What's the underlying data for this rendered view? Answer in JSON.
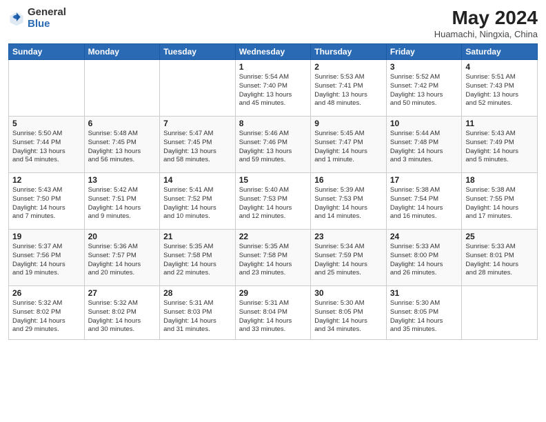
{
  "header": {
    "logo_general": "General",
    "logo_blue": "Blue",
    "month_title": "May 2024",
    "location": "Huamachi, Ningxia, China"
  },
  "days_of_week": [
    "Sunday",
    "Monday",
    "Tuesday",
    "Wednesday",
    "Thursday",
    "Friday",
    "Saturday"
  ],
  "weeks": [
    [
      {
        "day": "",
        "info": ""
      },
      {
        "day": "",
        "info": ""
      },
      {
        "day": "",
        "info": ""
      },
      {
        "day": "1",
        "info": "Sunrise: 5:54 AM\nSunset: 7:40 PM\nDaylight: 13 hours\nand 45 minutes."
      },
      {
        "day": "2",
        "info": "Sunrise: 5:53 AM\nSunset: 7:41 PM\nDaylight: 13 hours\nand 48 minutes."
      },
      {
        "day": "3",
        "info": "Sunrise: 5:52 AM\nSunset: 7:42 PM\nDaylight: 13 hours\nand 50 minutes."
      },
      {
        "day": "4",
        "info": "Sunrise: 5:51 AM\nSunset: 7:43 PM\nDaylight: 13 hours\nand 52 minutes."
      }
    ],
    [
      {
        "day": "5",
        "info": "Sunrise: 5:50 AM\nSunset: 7:44 PM\nDaylight: 13 hours\nand 54 minutes."
      },
      {
        "day": "6",
        "info": "Sunrise: 5:48 AM\nSunset: 7:45 PM\nDaylight: 13 hours\nand 56 minutes."
      },
      {
        "day": "7",
        "info": "Sunrise: 5:47 AM\nSunset: 7:45 PM\nDaylight: 13 hours\nand 58 minutes."
      },
      {
        "day": "8",
        "info": "Sunrise: 5:46 AM\nSunset: 7:46 PM\nDaylight: 13 hours\nand 59 minutes."
      },
      {
        "day": "9",
        "info": "Sunrise: 5:45 AM\nSunset: 7:47 PM\nDaylight: 14 hours\nand 1 minute."
      },
      {
        "day": "10",
        "info": "Sunrise: 5:44 AM\nSunset: 7:48 PM\nDaylight: 14 hours\nand 3 minutes."
      },
      {
        "day": "11",
        "info": "Sunrise: 5:43 AM\nSunset: 7:49 PM\nDaylight: 14 hours\nand 5 minutes."
      }
    ],
    [
      {
        "day": "12",
        "info": "Sunrise: 5:43 AM\nSunset: 7:50 PM\nDaylight: 14 hours\nand 7 minutes."
      },
      {
        "day": "13",
        "info": "Sunrise: 5:42 AM\nSunset: 7:51 PM\nDaylight: 14 hours\nand 9 minutes."
      },
      {
        "day": "14",
        "info": "Sunrise: 5:41 AM\nSunset: 7:52 PM\nDaylight: 14 hours\nand 10 minutes."
      },
      {
        "day": "15",
        "info": "Sunrise: 5:40 AM\nSunset: 7:53 PM\nDaylight: 14 hours\nand 12 minutes."
      },
      {
        "day": "16",
        "info": "Sunrise: 5:39 AM\nSunset: 7:53 PM\nDaylight: 14 hours\nand 14 minutes."
      },
      {
        "day": "17",
        "info": "Sunrise: 5:38 AM\nSunset: 7:54 PM\nDaylight: 14 hours\nand 16 minutes."
      },
      {
        "day": "18",
        "info": "Sunrise: 5:38 AM\nSunset: 7:55 PM\nDaylight: 14 hours\nand 17 minutes."
      }
    ],
    [
      {
        "day": "19",
        "info": "Sunrise: 5:37 AM\nSunset: 7:56 PM\nDaylight: 14 hours\nand 19 minutes."
      },
      {
        "day": "20",
        "info": "Sunrise: 5:36 AM\nSunset: 7:57 PM\nDaylight: 14 hours\nand 20 minutes."
      },
      {
        "day": "21",
        "info": "Sunrise: 5:35 AM\nSunset: 7:58 PM\nDaylight: 14 hours\nand 22 minutes."
      },
      {
        "day": "22",
        "info": "Sunrise: 5:35 AM\nSunset: 7:58 PM\nDaylight: 14 hours\nand 23 minutes."
      },
      {
        "day": "23",
        "info": "Sunrise: 5:34 AM\nSunset: 7:59 PM\nDaylight: 14 hours\nand 25 minutes."
      },
      {
        "day": "24",
        "info": "Sunrise: 5:33 AM\nSunset: 8:00 PM\nDaylight: 14 hours\nand 26 minutes."
      },
      {
        "day": "25",
        "info": "Sunrise: 5:33 AM\nSunset: 8:01 PM\nDaylight: 14 hours\nand 28 minutes."
      }
    ],
    [
      {
        "day": "26",
        "info": "Sunrise: 5:32 AM\nSunset: 8:02 PM\nDaylight: 14 hours\nand 29 minutes."
      },
      {
        "day": "27",
        "info": "Sunrise: 5:32 AM\nSunset: 8:02 PM\nDaylight: 14 hours\nand 30 minutes."
      },
      {
        "day": "28",
        "info": "Sunrise: 5:31 AM\nSunset: 8:03 PM\nDaylight: 14 hours\nand 31 minutes."
      },
      {
        "day": "29",
        "info": "Sunrise: 5:31 AM\nSunset: 8:04 PM\nDaylight: 14 hours\nand 33 minutes."
      },
      {
        "day": "30",
        "info": "Sunrise: 5:30 AM\nSunset: 8:05 PM\nDaylight: 14 hours\nand 34 minutes."
      },
      {
        "day": "31",
        "info": "Sunrise: 5:30 AM\nSunset: 8:05 PM\nDaylight: 14 hours\nand 35 minutes."
      },
      {
        "day": "",
        "info": ""
      }
    ]
  ]
}
